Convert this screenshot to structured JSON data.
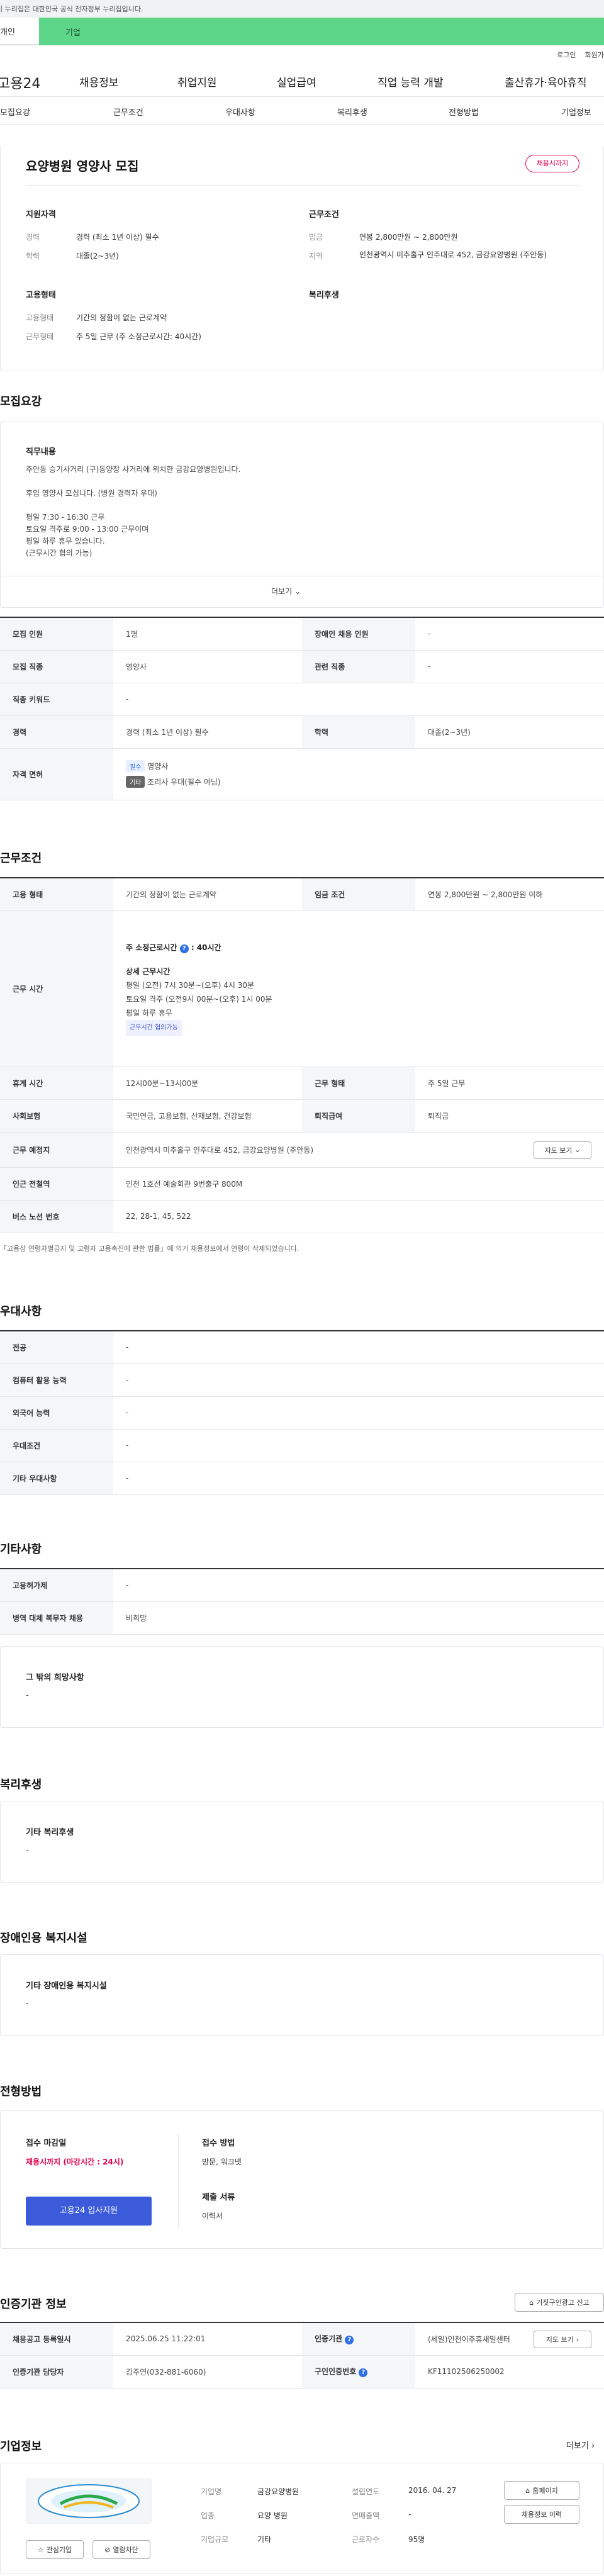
{
  "gov_notice": "이 누리집은 대한민국 공식 전자정부 누리집입니다.",
  "tabs": [
    "개인",
    "기업"
  ],
  "util_links": [
    "로그인",
    "회원가입"
  ],
  "gnb": {
    "logo": "고용24",
    "menus": [
      "채용정보",
      "취업지원",
      "실업급여",
      "직업 능력 개발",
      "출산휴가·육아휴직"
    ]
  },
  "subnav": [
    "모집요강",
    "근무조건",
    "우대사항",
    "복리후생",
    "전형방법",
    "기업정보"
  ],
  "summary": {
    "title": "요양병원 영양사 모집",
    "status_badge": "채용시까지",
    "qual_title": "지원자격",
    "career_label": "경력",
    "career_value": "경력 (최소 1년 이상) 필수",
    "edu_label": "학력",
    "edu_value": "대졸(2~3년)",
    "cond_title": "근무조건",
    "wage_label": "임금",
    "wage_value": "연봉 2,800만원 ~ 2,800만원",
    "region_label": "지역",
    "region_value": "인천광역시 미추홀구 인주대로 452, 금강요양병원 (주안동)",
    "emp_title": "고용형태",
    "emp_type_label": "고용형태",
    "emp_type_value": "기간의 정함이 없는 근로계약",
    "work_form_label": "근무형태",
    "work_form_value": "주 5일 근무 (주 소정근로시간: 40시간)",
    "welfare_title": "복리후생"
  },
  "recruit": {
    "title": "모집요강",
    "duty_title": "직무내용",
    "duty_lines": [
      "주안동 승기사거리 (구)동양장 사거리에 위치한 금강요양병원입니다.",
      "",
      "후임 영양사 모십니다. (병원 경력자 우대)",
      "",
      "평일 7:30 - 16:30 근무",
      "토요일 격주로 9:00 - 13:00 근무이며",
      "평일 하루 휴무 있습니다.",
      "(근무시간 협의 가능)"
    ],
    "more_label": "더보기",
    "rows": {
      "headcount_label": "모집 인원",
      "headcount_value": "1명",
      "disabled_label": "장애인 채용 인원",
      "disabled_value": "-",
      "job_label": "모집 직종",
      "job_value": "영양사",
      "related_label": "관련 직종",
      "related_value": "-",
      "keyword_label": "직종 키워드",
      "keyword_value": "-",
      "career_label": "경력",
      "career_value": "경력 (최소 1년 이상) 필수",
      "edu_label": "학력",
      "edu_value": "대졸(2~3년)",
      "license_label": "자격 면허",
      "license_req_badge": "필수",
      "license_req_value": "영양사",
      "license_pref_badge": "기타",
      "license_pref_value": "조리사 우대(필수 아님)"
    }
  },
  "conditions": {
    "title": "근무조건",
    "emp_label": "고용 형태",
    "emp_value": "기간의 정함이 없는 근로계약",
    "wage_label": "임금 조건",
    "wage_value": "연봉 2,800만원 ~ 2,800만원 이하",
    "hours_label": "근무 시간",
    "hours_main": "주 소정근로시간",
    "hours_main_value": ": 40시간",
    "hours_detail_title": "상세 근무시간",
    "hours_lines": [
      "평일 (오전) 7시 30분~(오후) 4시 30분",
      "토요일 격주 (오전9시 00분~(오후) 1시 00분",
      "평일 하루 휴무"
    ],
    "hours_badge": "근무시간 협의가능",
    "break_label": "휴게 시간",
    "break_value": "12시00분~13시00분",
    "form_label": "근무 형태",
    "form_value": "주 5일 근무",
    "insurance_label": "사회보험",
    "insurance_value": "국민연금, 고용보험, 산재보험, 건강보험",
    "retire_label": "퇴직급여",
    "retire_value": "퇴직금",
    "place_label": "근무 예정지",
    "place_value": "인천광역시 미추홀구 인주대로 452, 금강요양병원 (주안동)",
    "map_btn": "지도 보기",
    "subway_label": "인근 전철역",
    "subway_value": "인천 1호선 예술회관 9번출구 800M",
    "bus_label": "버스 노선 번호",
    "bus_value": "22, 28-1, 45, 522",
    "footnote": "「고용상 연령차별금지 및 고령자 고용촉진에 관한 법률」에 의거 채용정보에서 연령이 삭제되었습니다."
  },
  "preference": {
    "title": "우대사항",
    "rows": [
      {
        "label": "전공",
        "value": "-"
      },
      {
        "label": "컴퓨터 활용 능력",
        "value": "-"
      },
      {
        "label": "외국어 능력",
        "value": "-"
      },
      {
        "label": "우대조건",
        "value": "-"
      },
      {
        "label": "기타 우대사항",
        "value": "-"
      }
    ]
  },
  "other": {
    "title": "기타사항",
    "rows": [
      {
        "label": "고용허가제",
        "value": "-"
      },
      {
        "label": "병역 대체 복무자 채용",
        "value": "비희망"
      }
    ],
    "box_title": "그 밖의 희망사항",
    "box_value": "-"
  },
  "welfare": {
    "title": "복리후생",
    "box_title": "기타 복리후생",
    "box_value": "-"
  },
  "disability": {
    "title": "장애인용 복지시설",
    "box_title": "기타 장애인용 복지시설",
    "box_value": "-"
  },
  "process": {
    "title": "전형방법",
    "deadline_label": "접수 마감일",
    "deadline_value": "채용시까지 (마감시간 : 24시)",
    "apply_btn": "고용24 입사지원",
    "method_label": "접수 방법",
    "method_value": "방문, 워크넷",
    "docs_label": "제출 서류",
    "docs_value": "이력서"
  },
  "agency": {
    "title": "인증기관 정보",
    "report_btn": "거짓구인광고 신고",
    "reg_label": "채용공고 등록일시",
    "reg_value": "2025.06.25 11:22:01",
    "cert_label": "인증기관",
    "cert_value": "(세일)인천이주휴새일센터",
    "map_btn": "지도 보기",
    "contact_label": "인증기관 담당자",
    "contact_value": "김주연(032-881-6060)",
    "reqno_label": "구인인증번호",
    "reqno_value": "KF11102506250002"
  },
  "company": {
    "title": "기업정보",
    "more": "더보기",
    "name_label": "기업명",
    "name_value": "금강요양병원",
    "found_label": "설립연도",
    "found_value": "2016. 04. 27",
    "industry_label": "업종",
    "industry_value": "요양 병원",
    "sales_label": "연매출액",
    "sales_value": "-",
    "size_label": "기업규모",
    "size_value": "기타",
    "staff_label": "근로자수",
    "staff_value": "95명",
    "homepage_btn": "홈페이지",
    "jobs_btn": "채용정보 이력",
    "fav_btn": "관심기업",
    "block_btn": "열람차단"
  },
  "colors": {
    "accent_green": "#5ed68a",
    "red": "#e4004b",
    "blue": "#3b5bdb",
    "badge_blue": "#2f6fe4"
  }
}
